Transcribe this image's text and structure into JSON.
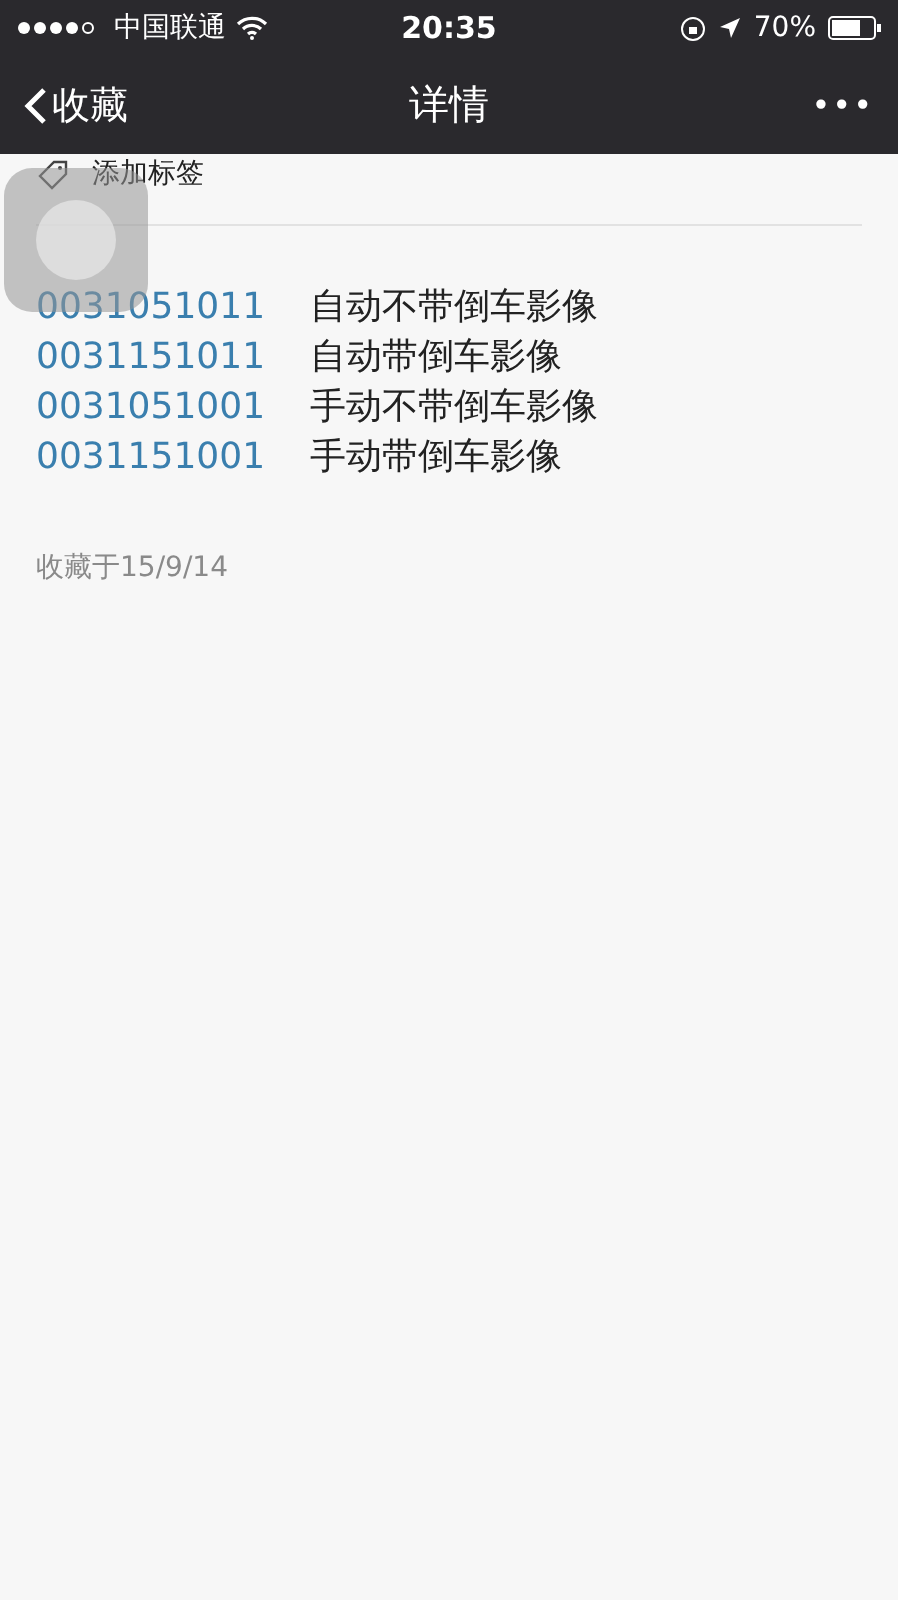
{
  "status_bar": {
    "carrier": "中国联通",
    "time": "20:35",
    "battery": "70%"
  },
  "nav": {
    "back": "收藏",
    "title": "详情",
    "more": "•••"
  },
  "tag": {
    "label": "添加标签"
  },
  "entries": [
    {
      "code": "0031051011",
      "desc": "自动不带倒车影像"
    },
    {
      "code": "0031151011",
      "desc": "自动带倒车影像"
    },
    {
      "code": "0031051001",
      "desc": "手动不带倒车影像"
    },
    {
      "code": "0031151001",
      "desc": "手动带倒车影像"
    }
  ],
  "saved": "收藏于15/9/14"
}
